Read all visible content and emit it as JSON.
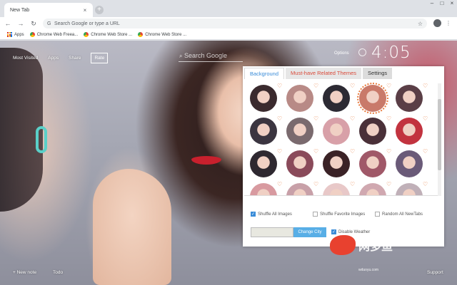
{
  "browser": {
    "tab_title": "New Tab",
    "tab_close": "×",
    "new_tab": "+",
    "window_controls": [
      "–",
      "□",
      "×"
    ],
    "omnibox_placeholder": "Search Google or type a URL",
    "bookmarks": [
      {
        "label": "Apps",
        "icon": "apps-grid-icon"
      },
      {
        "label": "Chrome Web Freea...",
        "icon": "chrome-web-store-icon"
      },
      {
        "label": "Chrome Web Store ...",
        "icon": "chrome-web-store-icon"
      },
      {
        "label": "Chrome Web Store ...",
        "icon": "chrome-web-store-icon"
      }
    ]
  },
  "topnav": {
    "most_visited": "Most Visited",
    "apps": "Apps",
    "share": "Share",
    "rate": "Rate"
  },
  "search": {
    "placeholder": "Search Google"
  },
  "options_label": "Options",
  "clock": "4:05",
  "bottom": {
    "new_note": "+ New note",
    "todo": "Todo",
    "support": "Support"
  },
  "panel": {
    "tabs": [
      "Background",
      "Must-have Related Themes",
      "Settings"
    ],
    "thumbnail_colors": [
      "#3a2a2e",
      "#b88a86",
      "#2c2a33",
      "#c97a6a",
      "#5a3e46",
      "#3b3540",
      "#7a6a6e",
      "#d8a0a8",
      "#4a3038",
      "#c2333f",
      "#2e2830",
      "#8a4a5a",
      "#3a2226",
      "#a05868",
      "#6a5a78",
      "#d89aa0",
      "#c8a0a8",
      "#e8c8c8",
      "#d0a8b0",
      "#c0b0b8"
    ],
    "selected_thumbnail_index": 3,
    "checkboxes": [
      {
        "label": "Shuffle All Images",
        "checked": true
      },
      {
        "label": "Shuffle Favorite Images",
        "checked": false
      },
      {
        "label": "Random All NewTabs",
        "checked": false
      }
    ],
    "change_city": "Change City",
    "disable_weather": {
      "label": "Disable Weather",
      "checked": true
    }
  },
  "watermark": {
    "text": "网多鱼",
    "sub": "wduoyu.com"
  }
}
